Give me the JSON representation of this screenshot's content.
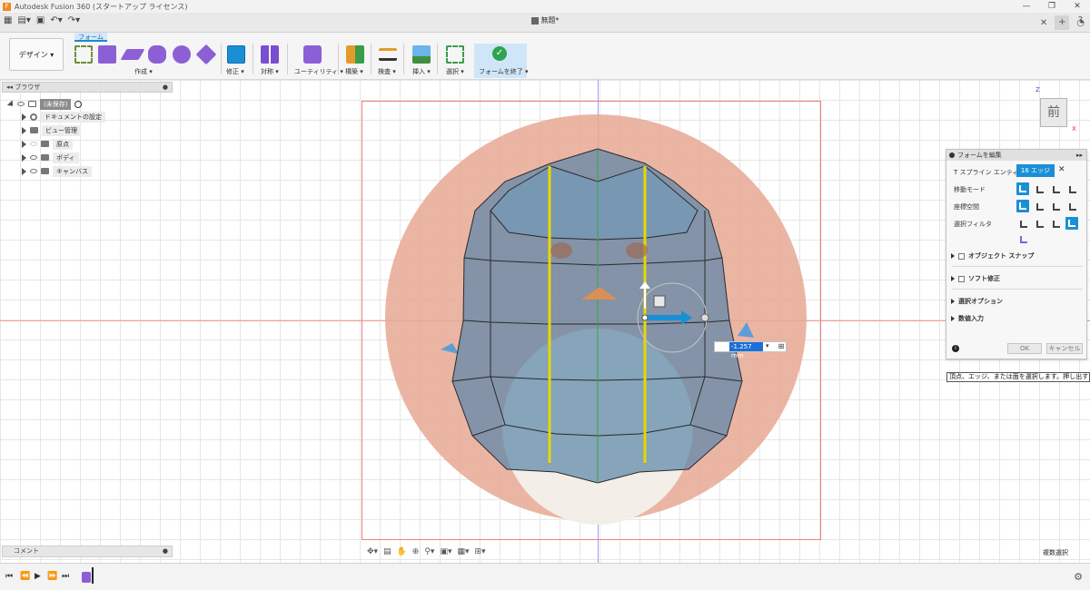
{
  "window": {
    "title": "Autodesk Fusion 360 (スタートアップ ライセンス)",
    "minimize": "—",
    "maximize": "❐",
    "close": "✕"
  },
  "document": {
    "tab_title": "無題*"
  },
  "ribbon": {
    "design_menu": "デザイン ▾",
    "workspace_tab": "フォーム",
    "groups": {
      "create": "作成 ▾",
      "modify": "修正 ▾",
      "symmetry": "対称 ▾",
      "utility": "ユーティリティ ▾",
      "construct": "構築 ▾",
      "inspect": "検査 ▾",
      "insert": "挿入 ▾",
      "select": "選択 ▾",
      "finish_form": "フォームを終了 ▾"
    }
  },
  "browser": {
    "header": "ブラウザ",
    "items": [
      {
        "label": "(未保存)"
      },
      {
        "label": "ドキュメントの設定"
      },
      {
        "label": "ビュー管理"
      },
      {
        "label": "原点"
      },
      {
        "label": "ボディ"
      },
      {
        "label": "キャンバス"
      }
    ]
  },
  "comments": {
    "label": "コメント"
  },
  "viewcube": {
    "face": "前",
    "z_axis": "Z",
    "x_axis": "X"
  },
  "edit_form": {
    "title": "フォームを編集",
    "tspline_entity_label": "T スプライン エンティティ",
    "entity_value": "16 エッジ",
    "transform_mode_label": "移動モード",
    "coordinate_space_label": "座標空間",
    "selection_filter_label": "選択フィルタ",
    "object_snap": "オブジェクト スナップ",
    "soft_modification": "ソフト修正",
    "selection_options": "選択オプション",
    "numeric_input": "数値入力",
    "ok": "OK",
    "cancel": "キャンセル"
  },
  "tooltip": {
    "text": "頂点、エッジ、または面を選択します。押し出すには、"
  },
  "distance_input": {
    "value": "-1.257 mm"
  },
  "status": {
    "multi_select": "複数選択"
  },
  "colors": {
    "accent": "#1b8fd6",
    "canvas_image": "#e8a08c",
    "model_blue": "#7ba7c9",
    "selected_edge": "#e6d800",
    "finish_green": "#2ea44f"
  }
}
